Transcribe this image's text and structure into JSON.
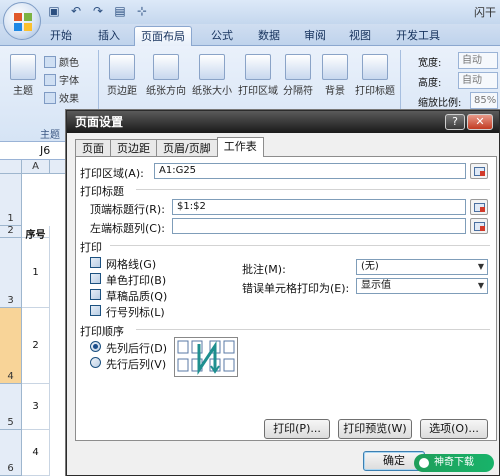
{
  "app": {
    "title": "闪干"
  },
  "ribbon_tabs": [
    "开始",
    "插入",
    "页面布局",
    "公式",
    "数据",
    "审阅",
    "视图",
    "开发工具"
  ],
  "ribbon": {
    "theme_group": {
      "label": "主题",
      "theme_btn": "主题",
      "colors": "颜色",
      "fonts": "字体",
      "effects": "效果"
    },
    "buttons": [
      "页边距",
      "纸张方向",
      "纸张大小",
      "打印区域",
      "分隔符",
      "背景",
      "打印标题"
    ],
    "scale": {
      "width_label": "宽度:",
      "height_label": "高度:",
      "scale_label": "缩放比例:",
      "width_value": "自动",
      "height_value": "自动",
      "scale_value": "85%"
    }
  },
  "name_box": "J6",
  "sheet": {
    "col_a": "A",
    "header_cell": "序号",
    "rows": [
      "1",
      "2",
      "3",
      "4",
      "5",
      "6"
    ],
    "cells": [
      "1",
      "2",
      "3",
      "4"
    ]
  },
  "dialog": {
    "title": "页面设置",
    "tabs": [
      "页面",
      "页边距",
      "页眉/页脚",
      "工作表"
    ],
    "print_area_label": "打印区域(A):",
    "print_area_value": "A1:G25",
    "print_titles_label": "打印标题",
    "top_rows_label": "顶端标题行(R):",
    "top_rows_value": "$1:$2",
    "left_cols_label": "左端标题列(C):",
    "left_cols_value": "",
    "print_label": "打印",
    "checkboxes": [
      "网格线(G)",
      "单色打印(B)",
      "草稿品质(Q)",
      "行号列标(L)"
    ],
    "comments_label": "批注(M):",
    "comments_value": "(无)",
    "errors_label": "错误单元格打印为(E):",
    "errors_value": "显示值",
    "order_label": "打印顺序",
    "order_options": [
      "先列后行(D)",
      "先行后列(V)"
    ],
    "buttons": {
      "print": "打印(P)...",
      "preview": "打印预览(W)",
      "options": "选项(O)...",
      "ok": "确定"
    }
  },
  "watermark": "神奇下载"
}
